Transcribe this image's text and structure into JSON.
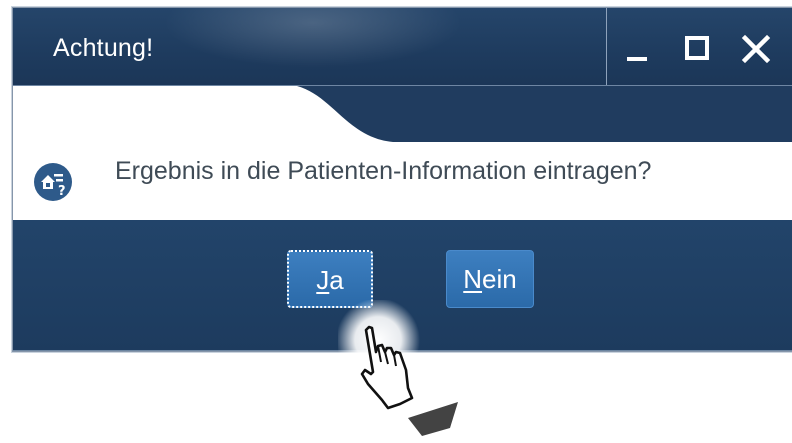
{
  "window": {
    "title": "Achtung!",
    "controls": [
      "minimize-icon",
      "maximize-icon",
      "close-icon"
    ]
  },
  "dialog": {
    "icon": "question-info-icon",
    "message": "Ergebnis in die Patienten-Information eintragen?"
  },
  "buttons": {
    "yes": {
      "accel": "J",
      "rest": "a"
    },
    "no": {
      "accel": "N",
      "rest": "ein"
    }
  },
  "colors": {
    "titlebar": "#1e3b5e",
    "button_bar": "#1d3b5e",
    "button": "#3474b6",
    "text": "#3f4b56"
  },
  "cursor": {
    "icon": "hand-pointer-icon"
  }
}
